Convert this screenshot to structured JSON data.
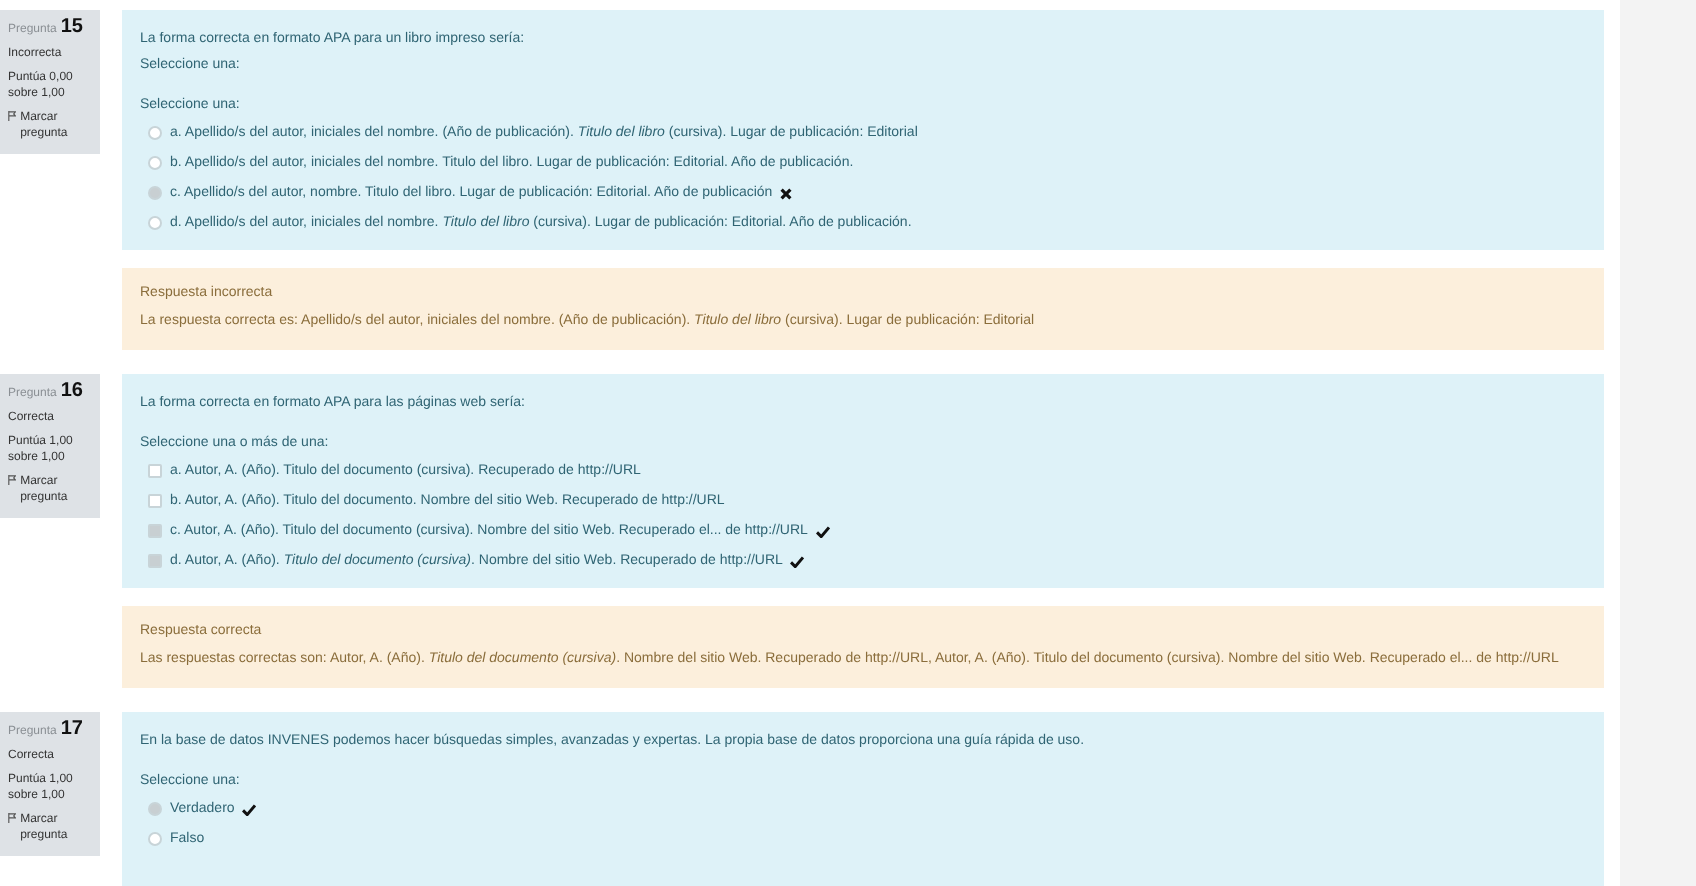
{
  "questions": [
    {
      "label": "Pregunta",
      "number": "15",
      "status": "Incorrecta",
      "score": "Puntúa 0,00 sobre 1,00",
      "flag": "Marcar pregunta",
      "prompt": [
        "La forma correcta en formato APA para un libro impreso sería:",
        "Seleccione una:"
      ],
      "instruction": "Seleccione una:",
      "kind": "radio",
      "options": [
        {
          "text": "a. Apellido/s del autor, iniciales del nombre. (Año de publicación). *Titulo del libro* (cursiva). Lugar de publicación: Editorial",
          "selected": false,
          "correct": false,
          "wrong": false
        },
        {
          "text": "b. Apellido/s del autor, iniciales del nombre. Titulo del libro. Lugar de publicación: Editorial. Año de publicación.",
          "selected": false,
          "correct": false,
          "wrong": false
        },
        {
          "text": "c. Apellido/s del autor, nombre. Titulo del libro. Lugar de publicación: Editorial. Año de publicación",
          "selected": true,
          "correct": false,
          "wrong": true
        },
        {
          "text": "d. Apellido/s del autor, iniciales del nombre. *Titulo del libro* (cursiva). Lugar de publicación: Editorial. Año de publicación.",
          "selected": false,
          "correct": false,
          "wrong": false
        }
      ],
      "feedback": {
        "title": "Respuesta incorrecta",
        "text": "La respuesta correcta es: Apellido/s del autor, iniciales del nombre. (Año de publicación). *Titulo del libro* (cursiva). Lugar de publicación: Editorial"
      }
    },
    {
      "label": "Pregunta",
      "number": "16",
      "status": "Correcta",
      "score": "Puntúa 1,00 sobre 1,00",
      "flag": "Marcar pregunta",
      "prompt": [
        "La forma correcta en formato APA para las páginas web sería:"
      ],
      "instruction": "Seleccione una o más de una:",
      "kind": "checkbox",
      "options": [
        {
          "text": "a. Autor, A. (Año). Titulo del documento (cursiva). Recuperado de http://URL",
          "selected": false,
          "correct": false,
          "wrong": false
        },
        {
          "text": "b. Autor, A. (Año). Titulo del documento.  Nombre del sitio Web. Recuperado de http://URL",
          "selected": false,
          "correct": false,
          "wrong": false
        },
        {
          "text": "c. Autor, A. (Año). Titulo del documento (cursiva). Nombre del sitio Web. Recuperado el... de http://URL",
          "selected": true,
          "correct": true,
          "wrong": false
        },
        {
          "text": "d.  Autor, A. (Año). *Titulo del documento (cursiva)*. Nombre del sitio Web. Recuperado de http://URL",
          "selected": true,
          "correct": true,
          "wrong": false
        }
      ],
      "feedback": {
        "title": "Respuesta correcta",
        "text": "Las respuestas correctas son:  Autor, A. (Año). *Titulo del documento (cursiva)*. Nombre del sitio Web. Recuperado de http://URL, Autor, A. (Año). Titulo del documento (cursiva). Nombre del sitio Web. Recuperado el... de http://URL"
      }
    },
    {
      "label": "Pregunta",
      "number": "17",
      "status": "Correcta",
      "score": "Puntúa 1,00 sobre 1,00",
      "flag": "Marcar pregunta",
      "prompt": [
        "En la base de datos INVENES podemos hacer búsquedas simples, avanzadas y expertas. La propia base de datos proporciona una guía rápida de uso."
      ],
      "instruction": "Seleccione una:",
      "kind": "radio",
      "options": [
        {
          "text": "Verdadero",
          "selected": true,
          "correct": true,
          "wrong": false
        },
        {
          "text": "Falso",
          "selected": false,
          "correct": false,
          "wrong": false
        }
      ]
    }
  ]
}
